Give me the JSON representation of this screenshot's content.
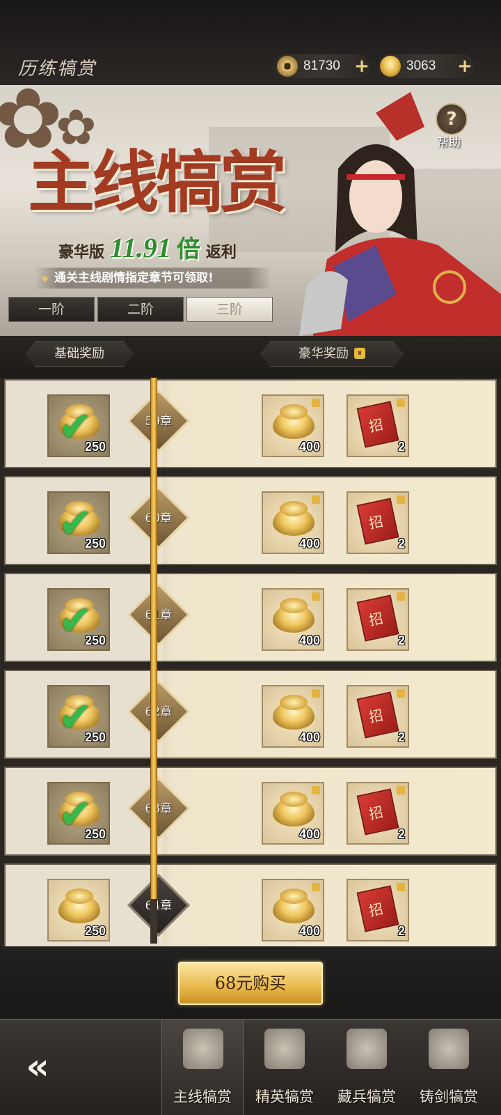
{
  "header": {
    "title": "历练犒赏",
    "currencies": [
      {
        "icon": "copper-coin-icon",
        "value": "81730"
      },
      {
        "icon": "gold-ingot-icon",
        "value": "3063"
      }
    ]
  },
  "banner": {
    "title": "主线犒赏",
    "edition": "豪华版",
    "multiplier": "11.91",
    "multiplier_unit": "倍",
    "rebate": "返利",
    "notice": "通关主线剧情指定章节可领取!",
    "help_label": "帮助"
  },
  "tiers": [
    "一阶",
    "二阶",
    "三阶"
  ],
  "active_tier": "三阶",
  "columns": {
    "basic": "基础奖励",
    "premium": "豪华奖励"
  },
  "rows": [
    {
      "chapter": "59章",
      "basic_qty": "250",
      "basic_claimed": true,
      "premium": [
        {
          "icon": "gold-ingot-icon",
          "qty": "400"
        },
        {
          "icon": "recruit-scroll-icon",
          "qty": "2"
        }
      ]
    },
    {
      "chapter": "60章",
      "basic_qty": "250",
      "basic_claimed": true,
      "premium": [
        {
          "icon": "gold-ingot-icon",
          "qty": "400"
        },
        {
          "icon": "recruit-scroll-icon",
          "qty": "2"
        }
      ]
    },
    {
      "chapter": "61章",
      "basic_qty": "250",
      "basic_claimed": true,
      "premium": [
        {
          "icon": "gold-ingot-icon",
          "qty": "400"
        },
        {
          "icon": "recruit-scroll-icon",
          "qty": "2"
        }
      ]
    },
    {
      "chapter": "62章",
      "basic_qty": "250",
      "basic_claimed": true,
      "premium": [
        {
          "icon": "gold-ingot-icon",
          "qty": "400"
        },
        {
          "icon": "recruit-scroll-icon",
          "qty": "2"
        }
      ]
    },
    {
      "chapter": "63章",
      "basic_qty": "250",
      "basic_claimed": true,
      "premium": [
        {
          "icon": "gold-ingot-icon",
          "qty": "400"
        },
        {
          "icon": "recruit-scroll-icon",
          "qty": "2"
        }
      ]
    },
    {
      "chapter": "64章",
      "basic_qty": "250",
      "basic_claimed": false,
      "premium": [
        {
          "icon": "gold-ingot-icon",
          "qty": "400"
        },
        {
          "icon": "recruit-scroll-icon",
          "qty": "2"
        }
      ]
    }
  ],
  "buy_button": "68元购买",
  "nav": [
    {
      "label": "主线犒赏",
      "active": true
    },
    {
      "label": "精英犒赏",
      "active": false
    },
    {
      "label": "藏兵犒赏",
      "active": false
    },
    {
      "label": "铸剑犒赏",
      "active": false
    }
  ],
  "colors": {
    "accent_gold": "#e8b94a",
    "claimed_check": "#37b84a",
    "title_red": "#a33a22",
    "multiplier_green": "#2f8d2c"
  }
}
